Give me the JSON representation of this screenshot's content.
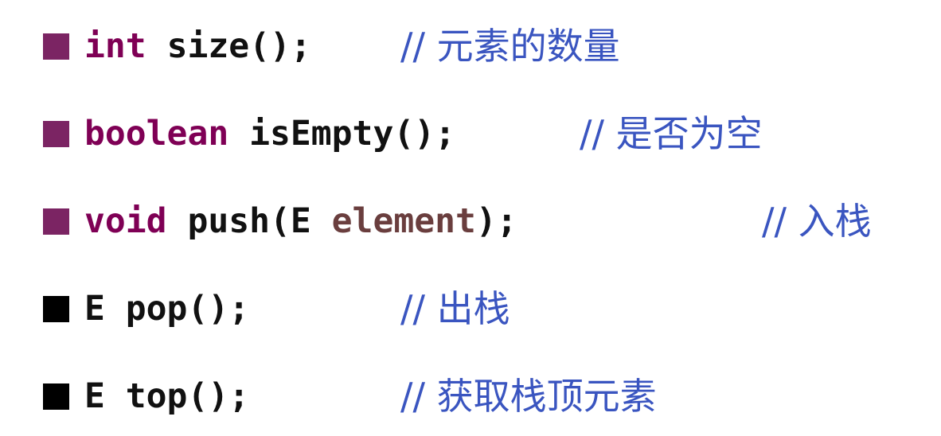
{
  "lines": [
    {
      "bullet_color": "#7b2463",
      "code": {
        "keyword": "int",
        "rest": "size();"
      },
      "comment": "// 元素的数量"
    },
    {
      "bullet_color": "#7b2463",
      "code": {
        "keyword": "boolean",
        "rest": "isEmpty();"
      },
      "comment": "// 是否为空"
    },
    {
      "bullet_color": "#7b2463",
      "code": {
        "keyword": "void",
        "before_param": "push(E ",
        "param": "element",
        "after_param": ");"
      },
      "comment": "// 入栈"
    },
    {
      "bullet_color": "#000000",
      "code": {
        "plain": "E pop();"
      },
      "comment": "// 出栈"
    },
    {
      "bullet_color": "#000000",
      "code": {
        "plain": "E top();"
      },
      "comment": "// 获取栈顶元素"
    }
  ],
  "colors": {
    "keyword": "#7f0055",
    "parameter": "#6a3e3e",
    "comment": "#3a55c0",
    "text": "#111111"
  }
}
